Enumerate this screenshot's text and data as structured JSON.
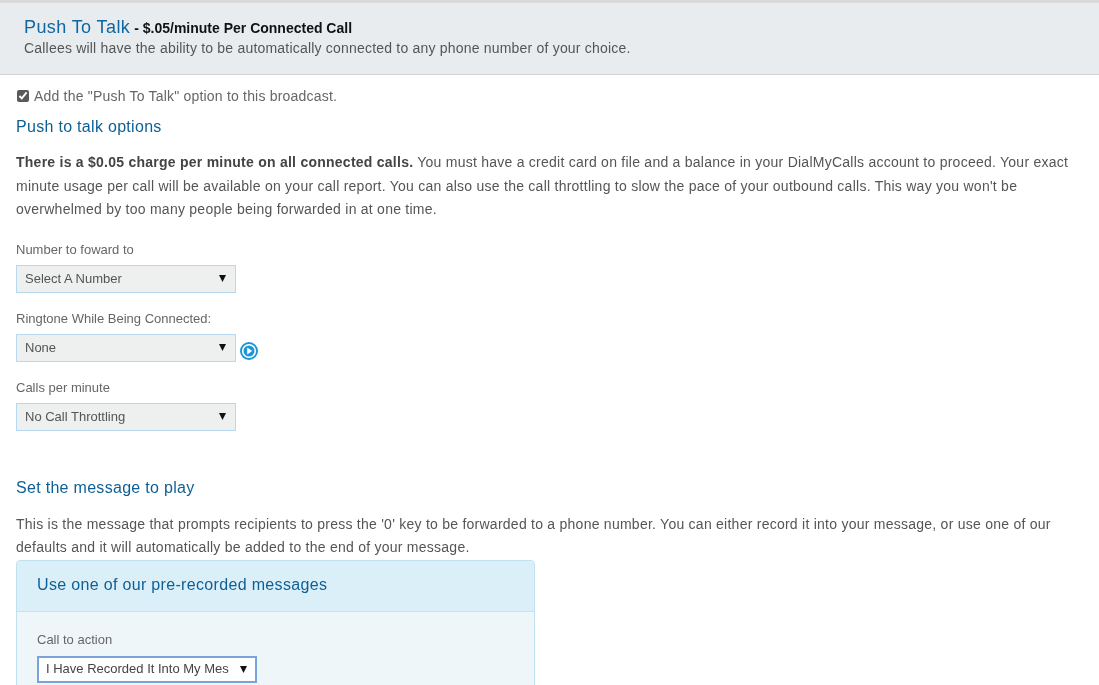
{
  "header": {
    "title": "Push To Talk",
    "price_note": "- $.05/minute Per Connected Call",
    "description": "Callees will have the ability to be automatically connected to any phone number of your choice."
  },
  "enable_option": {
    "label": "Add the \"Push To Talk\" option to this broadcast.",
    "checked": true
  },
  "options_section": {
    "heading": "Push to talk options",
    "notice": "**There is a $0.05 charge per minute on all connected calls.** You must have a credit card on file and a balance in your DialMyCalls account to proceed. Your exact minute usage per call will be available on your call report. You can also use the call throttling to slow the pace of your outbound calls. This way you won't be overwhelmed by too many people being forwarded in at one time.",
    "fields": [
      {
        "label": "Number to foward to",
        "value": "Select A Number",
        "play_button": false,
        "focused": false
      },
      {
        "label": "Ringtone While Being Connected:",
        "value": "None",
        "play_button": true,
        "focused": false
      },
      {
        "label": "Calls per minute",
        "value": "No Call Throttling",
        "play_button": false,
        "focused": false
      }
    ]
  },
  "message_section": {
    "heading": "Set the message to play",
    "description": "This is the message that prompts recipients to press the '0' key to be forwarded to a phone number. You can either record it into your message, or use one of our defaults and it will automatically be added to the end of your message.",
    "panel": {
      "title": "Use one of our pre-recorded messages",
      "fields": [
        {
          "label": "Call to action",
          "value": "I Have Recorded It Into My Mes",
          "play_button": false,
          "focused": true
        }
      ]
    }
  }
}
